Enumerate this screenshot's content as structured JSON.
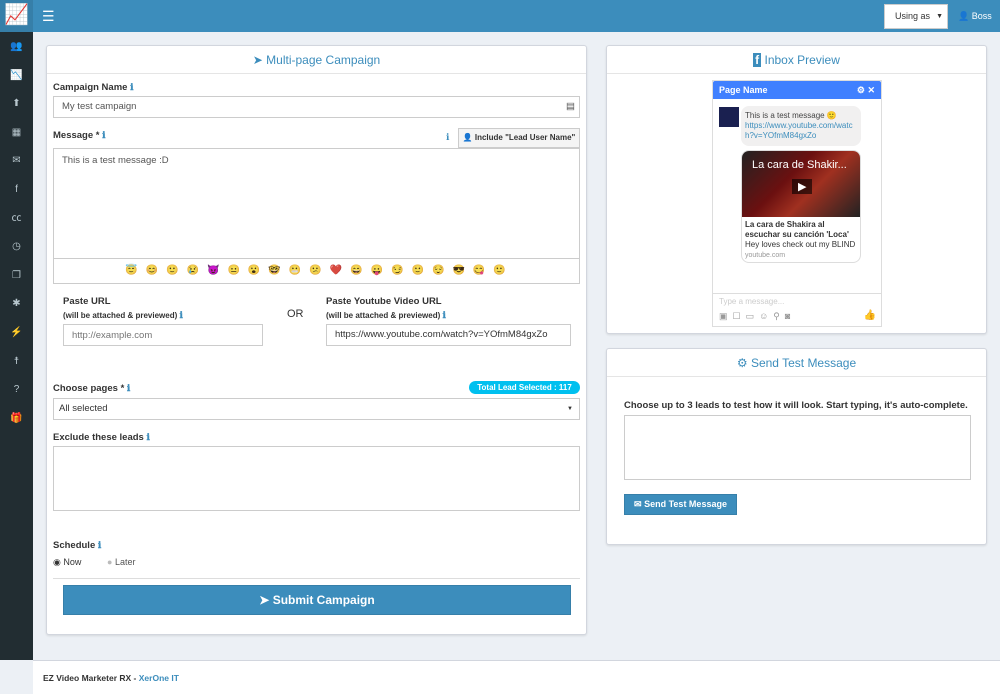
{
  "topbar": {
    "using_as": "Using as",
    "user": "Boss"
  },
  "sidebar": {
    "icons": [
      "user-plus-icon",
      "line-chart-icon",
      "upload-icon",
      "film-icon",
      "envelope-icon",
      "facebook-icon",
      "cc-icon",
      "clock-icon",
      "copy-icon",
      "asterisk-icon",
      "plug-icon",
      "child-icon",
      "question-icon",
      "gift-icon"
    ]
  },
  "campaign": {
    "title": "Multi-page Campaign",
    "name_label": "Campaign Name",
    "name_value": "My test campaign",
    "message_label": "Message *",
    "include_button": "Include \"Lead User Name\"",
    "message_value": "This is a test message  :D",
    "emojis": [
      "😇",
      "😊",
      "🙂",
      "😢",
      "😈",
      "😐",
      "😮",
      "🤓",
      "😬",
      "😕",
      "❤️",
      "😄",
      "😛",
      "😏",
      "🙂",
      "😌",
      "😎",
      "😋",
      "🙂"
    ],
    "paste_url_label": "Paste URL",
    "attached_note": "(will be attached & previewed)",
    "paste_url_placeholder": "http://example.com",
    "or": "OR",
    "youtube_label": "Paste Youtube Video URL",
    "youtube_value": "https://www.youtube.com/watch?v=YOfmM84gxZo",
    "pages_label": "Choose pages *",
    "total_badge": "Total Lead Selected : 117",
    "pages_value": "All selected",
    "exclude_label": "Exclude these leads",
    "schedule_label": "Schedule",
    "now": "Now",
    "later": "Later",
    "submit": "Submit Campaign"
  },
  "preview": {
    "title": "Inbox Preview",
    "page_name": "Page Name",
    "message": "This is a test message",
    "link": "https://www.youtube.com/watch?v=YOfmM84gxZo",
    "video_title_overlay": "La cara de Shakir...",
    "card_title": "La cara de Shakira al escuchar su canción 'Loca'",
    "card_desc": "Hey loves check out my BLIND",
    "card_domain": "youtube.com",
    "type_placeholder": "Type a message..."
  },
  "test": {
    "title": "Send Test Message",
    "instructions": "Choose up to 3 leads to test how it will look. Start typing, it's auto-complete.",
    "button": "Send Test Message"
  },
  "footer": {
    "app": "EZ Video Marketer RX",
    "sep": " - ",
    "company": "XerOne IT"
  },
  "colors": {
    "brand": "#3c8dbc",
    "sidebar": "#222d32",
    "badge": "#00c0ef",
    "messenger": "#4080ff"
  }
}
